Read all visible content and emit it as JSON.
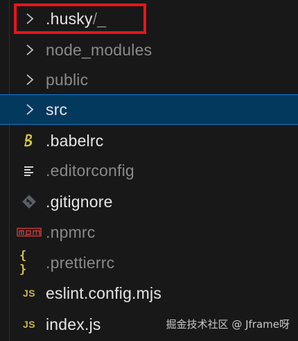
{
  "explorer": {
    "items": [
      {
        "kind": "folder",
        "name": ".husky",
        "suffix": "/_",
        "icon": "chevron-right-icon",
        "highlighted": true
      },
      {
        "kind": "folder",
        "name": "node_modules",
        "icon": "chevron-right-icon",
        "dimmed": true
      },
      {
        "kind": "folder",
        "name": "public",
        "icon": "chevron-right-icon",
        "dimmed": true
      },
      {
        "kind": "folder",
        "name": "src",
        "icon": "chevron-right-icon",
        "selected": true
      },
      {
        "kind": "file",
        "name": ".babelrc",
        "icon": "babel-icon"
      },
      {
        "kind": "file",
        "name": ".editorconfig",
        "icon": "editorconfig-icon",
        "dimmed": true
      },
      {
        "kind": "file",
        "name": ".gitignore",
        "icon": "git-icon"
      },
      {
        "kind": "file",
        "name": ".npmrc",
        "icon": "npm-icon",
        "icon_text": "npm",
        "dimmed": true
      },
      {
        "kind": "file",
        "name": ".prettierrc",
        "icon": "json-braces-icon",
        "icon_text": "{ }",
        "dimmed": true
      },
      {
        "kind": "file",
        "name": "eslint.config.mjs",
        "icon": "javascript-icon",
        "icon_text": "JS"
      },
      {
        "kind": "file",
        "name": "index.js",
        "icon": "javascript-icon",
        "icon_text": "JS"
      }
    ]
  },
  "watermark": "掘金技术社区 @ Jframe呀",
  "colors": {
    "background": "#181818",
    "selected_background": "#04395e",
    "selected_border": "#0a7ad2",
    "highlight_box": "#e8141b",
    "text": "#e6e6e6",
    "text_dimmed": "#8a8a8a",
    "js_icon": "#c9b94a",
    "npm_icon": "#c33a3a",
    "babel_icon": "#d5c743"
  }
}
